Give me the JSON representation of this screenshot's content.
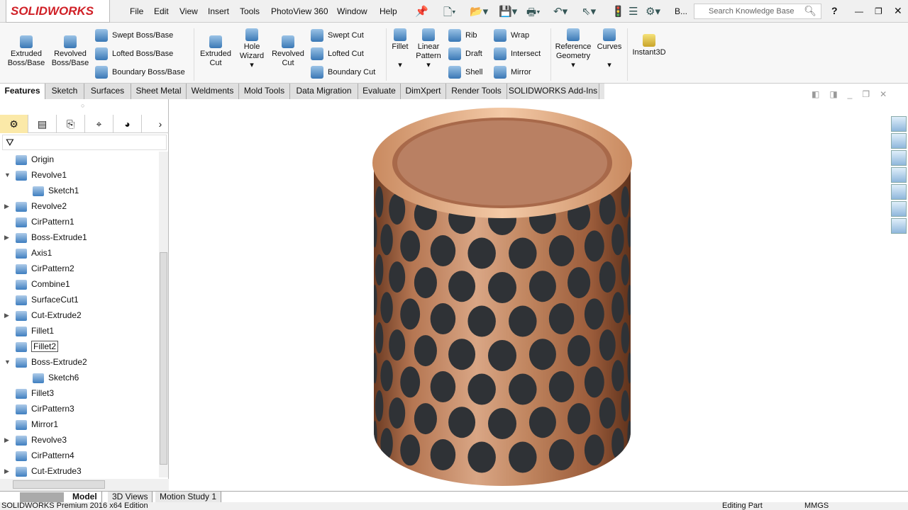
{
  "app": {
    "logo": "SOLIDWORKS",
    "menu": [
      "File",
      "Edit",
      "View",
      "Insert",
      "Tools",
      "PhotoView 360",
      "Window",
      "Help"
    ],
    "search_placeholder": "Search Knowledge Base",
    "more": "B...",
    "help": "?"
  },
  "ribbon": {
    "big": [
      "Extruded Boss/Base",
      "Revolved Boss/Base",
      "Extruded Cut",
      "Hole Wizard",
      "Revolved Cut",
      "Fillet",
      "Linear Pattern",
      "Reference Geometry",
      "Curves",
      "Instant3D"
    ],
    "small": [
      "Swept Boss/Base",
      "Lofted Boss/Base",
      "Boundary Boss/Base",
      "Swept Cut",
      "Lofted Cut",
      "Boundary Cut",
      "Rib",
      "Draft",
      "Shell",
      "Wrap",
      "Intersect",
      "Mirror"
    ]
  },
  "tabs": [
    "Features",
    "Sketch",
    "Surfaces",
    "Sheet Metal",
    "Weldments",
    "Mold Tools",
    "Data Migration",
    "Evaluate",
    "DimXpert",
    "Render Tools",
    "SOLIDWORKS Add-Ins"
  ],
  "tree": [
    {
      "label": "Origin",
      "exp": ""
    },
    {
      "label": "Revolve1",
      "exp": "▼"
    },
    {
      "label": "Sketch1",
      "exp": "",
      "indent": 1
    },
    {
      "label": "Revolve2",
      "exp": "▶"
    },
    {
      "label": "CirPattern1",
      "exp": ""
    },
    {
      "label": "Boss-Extrude1",
      "exp": "▶"
    },
    {
      "label": "Axis1",
      "exp": ""
    },
    {
      "label": "CirPattern2",
      "exp": ""
    },
    {
      "label": "Combine1",
      "exp": ""
    },
    {
      "label": "SurfaceCut1",
      "exp": ""
    },
    {
      "label": "Cut-Extrude2",
      "exp": "▶"
    },
    {
      "label": "Fillet1",
      "exp": ""
    },
    {
      "label": "Fillet2",
      "exp": "",
      "selected": true
    },
    {
      "label": "Boss-Extrude2",
      "exp": "▼"
    },
    {
      "label": "Sketch6",
      "exp": "",
      "indent": 1
    },
    {
      "label": "Fillet3",
      "exp": ""
    },
    {
      "label": "CirPattern3",
      "exp": ""
    },
    {
      "label": "Mirror1",
      "exp": ""
    },
    {
      "label": "Revolve3",
      "exp": "▶"
    },
    {
      "label": "CirPattern4",
      "exp": ""
    },
    {
      "label": "Cut-Extrude3",
      "exp": "▶"
    }
  ],
  "bottom_tabs": [
    "Model",
    "3D Views",
    "Motion Study 1"
  ],
  "status": {
    "left": "SOLIDWORKS Premium 2016 x64 Edition",
    "mode": "Editing Part",
    "units": "MMGS"
  }
}
